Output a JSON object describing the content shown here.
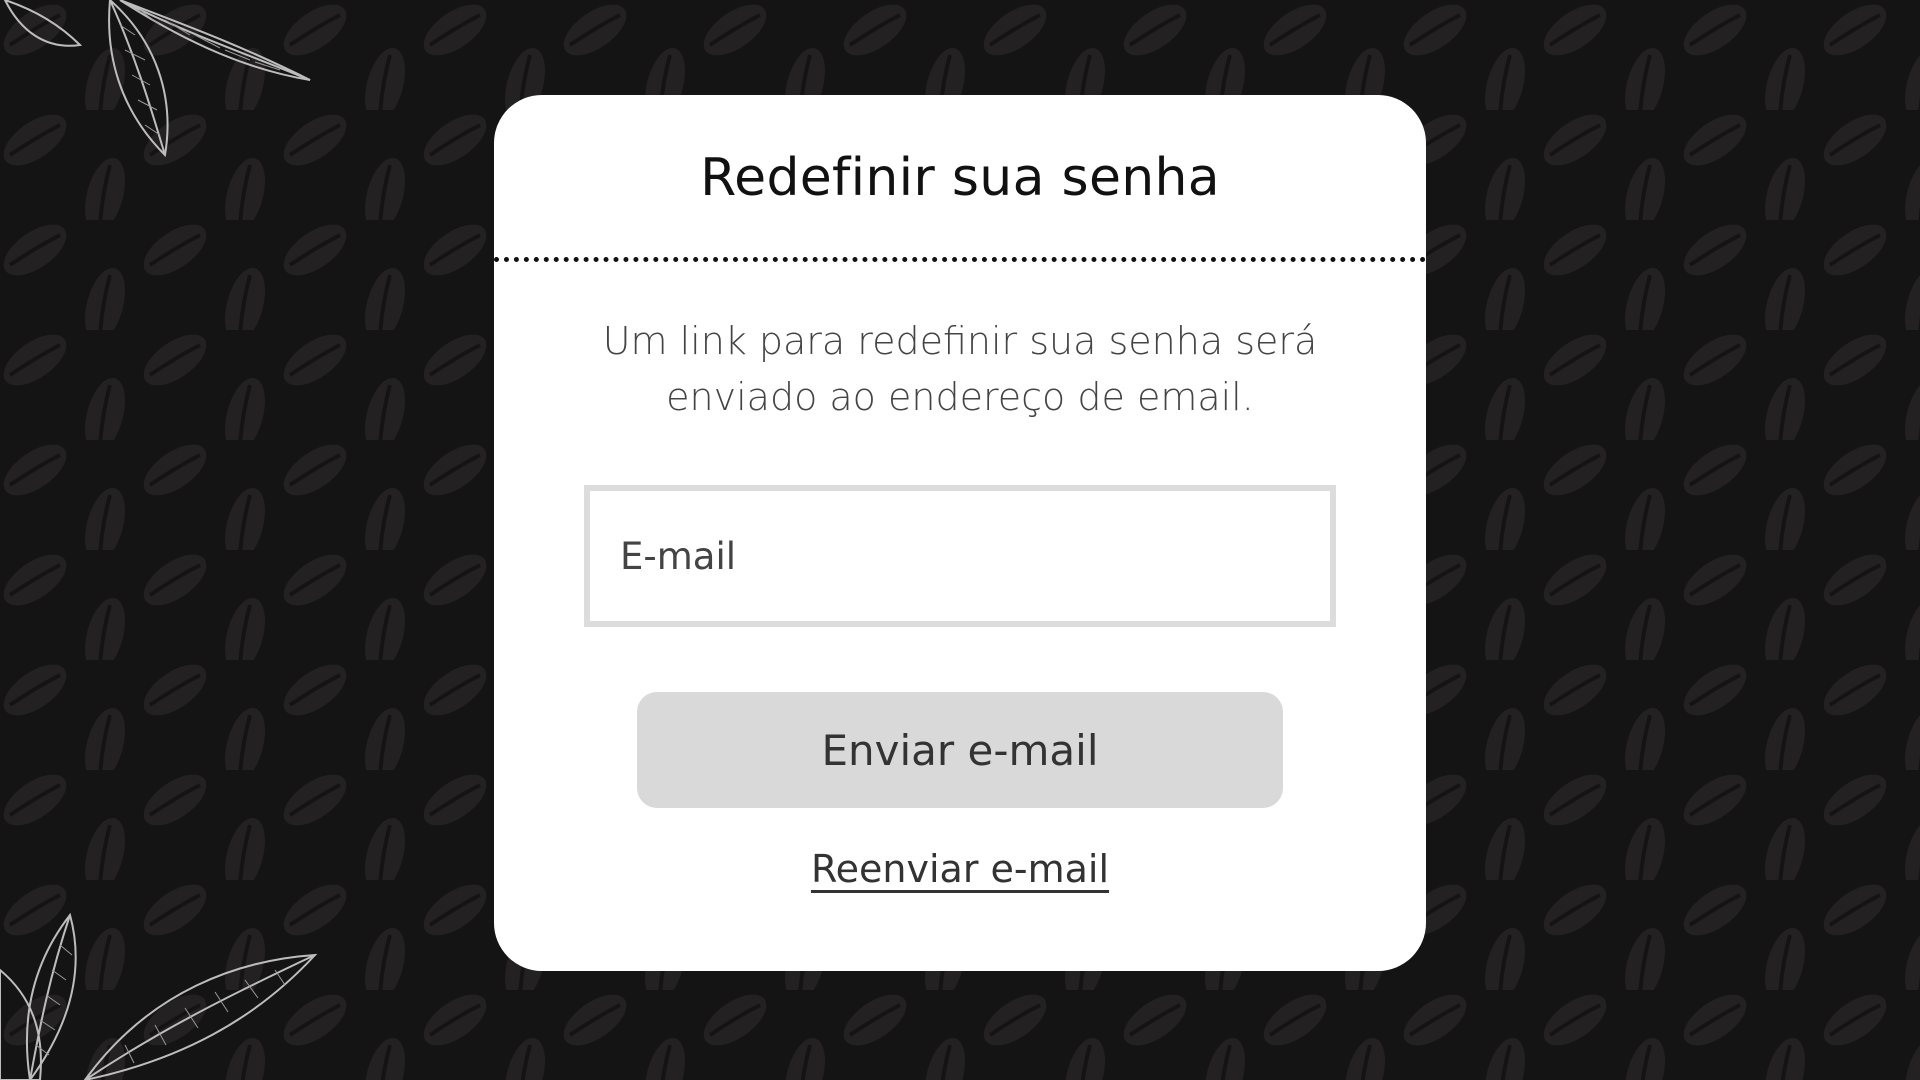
{
  "dialog": {
    "title": "Redefinir sua senha",
    "description": "Um link para redefinir sua senha será enviado ao endereço de email.",
    "email_placeholder": "E-mail",
    "email_value": "",
    "send_button_label": "Enviar e-mail",
    "resend_link_label": "Reenviar e-mail"
  },
  "colors": {
    "background": "#151414",
    "pattern": "#252323",
    "card": "#ffffff",
    "button": "#d9d9d9",
    "field_border": "#dcdcdc",
    "text": "#333333"
  },
  "decorations": {
    "background_pattern": "coffee-bean-pattern",
    "corner_leaves": "leaf-illustration"
  }
}
